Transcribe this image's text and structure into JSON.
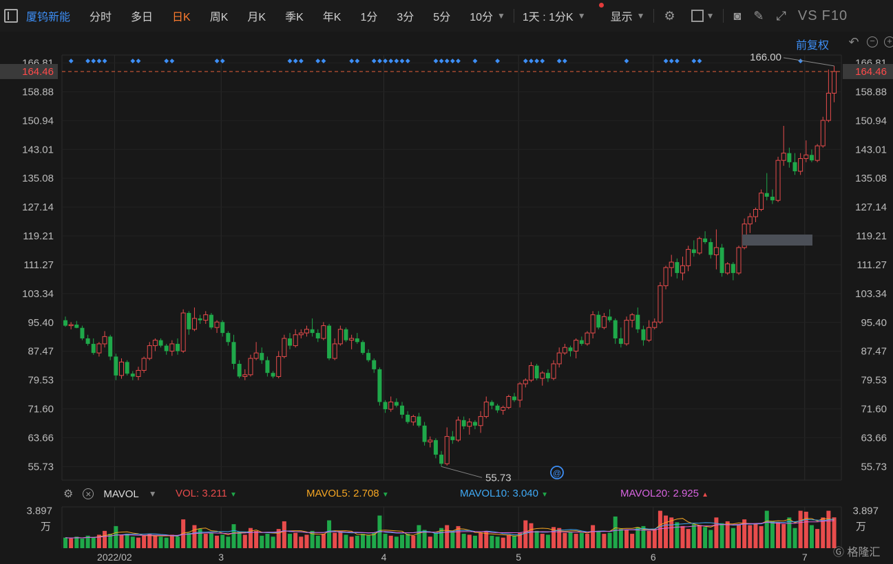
{
  "toolbar": {
    "stock_name": "厦钨新能",
    "periods": [
      "分时",
      "多日",
      "日K",
      "周K",
      "月K",
      "季K",
      "年K",
      "1分",
      "3分",
      "5分",
      "10分"
    ],
    "active_period": "日K",
    "interval": "1天 : 1分K",
    "display": "显示",
    "vs_label": "VS",
    "f10_label": "F10"
  },
  "adjust_label": "前复权",
  "price_axis": {
    "ticks": [
      "166.81",
      "158.88",
      "150.94",
      "143.01",
      "135.08",
      "127.14",
      "119.21",
      "111.27",
      "103.34",
      "95.40",
      "87.47",
      "79.53",
      "71.60",
      "63.66",
      "55.73"
    ],
    "current": "164.46",
    "max_label": "166.00",
    "min_label": "55.73"
  },
  "date_axis": {
    "labels": [
      {
        "text": "2022/02",
        "index": 9
      },
      {
        "text": "3",
        "index": 28
      },
      {
        "text": "4",
        "index": 57
      },
      {
        "text": "5",
        "index": 81
      },
      {
        "text": "6",
        "index": 105
      },
      {
        "text": "7",
        "index": 132
      }
    ]
  },
  "volume_panel": {
    "name": "MAVOL",
    "vol_label": "VOL:",
    "vol_value": "3.211",
    "mavol5_label": "MAVOL5:",
    "mavol5_value": "2.708",
    "mavol10_label": "MAVOL10:",
    "mavol10_value": "3.040",
    "mavol20_label": "MAVOL20:",
    "mavol20_value": "2.925",
    "axis_top": "3.897",
    "axis_unit": "万",
    "colors": {
      "vol": "#e84c4c",
      "mavol5": "#f5a623",
      "mavol10": "#3fa9f5",
      "mavol20": "#d864e0"
    }
  },
  "brand": "格隆汇",
  "colors": {
    "up": "#e84c4c",
    "down": "#1fa84a",
    "accent": "#3d8ef5",
    "current_line": "#e8613a"
  },
  "chart_data": {
    "type": "candlestick",
    "price_range": [
      52,
      169
    ],
    "ohlc": [
      [
        96.0,
        97.0,
        94.2,
        94.5
      ],
      [
        94.5,
        95.5,
        93.5,
        94.8
      ],
      [
        94.8,
        95.8,
        93.8,
        93.9
      ],
      [
        93.9,
        94.5,
        90.5,
        91.0
      ],
      [
        91.0,
        92.0,
        89.0,
        89.5
      ],
      [
        89.5,
        91.0,
        86.5,
        87.0
      ],
      [
        87.0,
        90.0,
        86.0,
        89.5
      ],
      [
        89.5,
        93.0,
        88.5,
        91.5
      ],
      [
        91.5,
        92.0,
        85.0,
        86.0
      ],
      [
        86.0,
        86.8,
        79.5,
        80.8
      ],
      [
        80.8,
        85.5,
        79.9,
        84.5
      ],
      [
        84.5,
        85.0,
        80.8,
        81.3
      ],
      [
        81.3,
        82.0,
        79.5,
        80.5
      ],
      [
        80.5,
        83.2,
        79.5,
        82.2
      ],
      [
        82.2,
        86.0,
        81.5,
        85.5
      ],
      [
        85.5,
        90.0,
        85.0,
        89.0
      ],
      [
        89.0,
        91.0,
        87.5,
        90.5
      ],
      [
        90.5,
        91.0,
        88.5,
        89.0
      ],
      [
        89.0,
        89.5,
        86.5,
        87.5
      ],
      [
        87.5,
        90.5,
        86.2,
        89.5
      ],
      [
        89.5,
        91.0,
        86.5,
        87.5
      ],
      [
        87.5,
        99.0,
        87.0,
        98.0
      ],
      [
        98.0,
        98.5,
        92.0,
        93.5
      ],
      [
        93.5,
        99.5,
        93.0,
        96.5
      ],
      [
        96.5,
        97.5,
        95.0,
        96.0
      ],
      [
        96.0,
        98.5,
        95.0,
        97.5
      ],
      [
        97.5,
        98.0,
        93.5,
        94.0
      ],
      [
        94.0,
        96.0,
        92.5,
        95.5
      ],
      [
        95.5,
        96.0,
        91.5,
        92.5
      ],
      [
        92.5,
        93.0,
        89.0,
        90.0
      ],
      [
        90.0,
        92.0,
        82.5,
        84.0
      ],
      [
        84.0,
        85.0,
        80.0,
        80.5
      ],
      [
        80.5,
        82.5,
        79.5,
        81.0
      ],
      [
        81.0,
        86.5,
        80.5,
        85.5
      ],
      [
        85.5,
        90.0,
        85.0,
        87.0
      ],
      [
        87.0,
        88.5,
        84.0,
        85.0
      ],
      [
        85.0,
        86.0,
        80.5,
        81.5
      ],
      [
        81.5,
        82.0,
        80.0,
        80.5
      ],
      [
        80.5,
        87.5,
        80.0,
        86.0
      ],
      [
        86.0,
        92.0,
        85.5,
        91.0
      ],
      [
        91.0,
        92.5,
        88.0,
        89.0
      ],
      [
        89.0,
        93.5,
        88.5,
        92.0
      ],
      [
        92.0,
        93.5,
        91.0,
        92.5
      ],
      [
        92.5,
        94.5,
        91.5,
        93.5
      ],
      [
        93.5,
        96.5,
        91.5,
        92.5
      ],
      [
        92.5,
        93.5,
        90.0,
        91.0
      ],
      [
        91.0,
        95.5,
        90.5,
        94.5
      ],
      [
        94.5,
        95.0,
        85.0,
        85.5
      ],
      [
        85.5,
        91.0,
        85.0,
        89.5
      ],
      [
        89.5,
        94.5,
        89.0,
        93.5
      ],
      [
        93.5,
        94.0,
        90.0,
        90.5
      ],
      [
        90.5,
        92.0,
        88.0,
        91.0
      ],
      [
        91.0,
        92.5,
        89.5,
        90.0
      ],
      [
        90.0,
        90.5,
        86.5,
        87.0
      ],
      [
        87.0,
        88.0,
        84.5,
        85.0
      ],
      [
        85.0,
        85.5,
        81.5,
        82.5
      ],
      [
        82.5,
        83.0,
        72.5,
        73.5
      ],
      [
        73.5,
        74.0,
        70.5,
        71.5
      ],
      [
        71.5,
        75.0,
        70.8,
        73.5
      ],
      [
        73.5,
        74.5,
        72.0,
        72.5
      ],
      [
        72.5,
        73.5,
        69.0,
        70.0
      ],
      [
        70.0,
        71.0,
        67.5,
        68.0
      ],
      [
        68.0,
        70.0,
        67.0,
        69.5
      ],
      [
        69.5,
        70.5,
        66.5,
        67.0
      ],
      [
        67.0,
        68.0,
        61.5,
        62.5
      ],
      [
        62.5,
        64.0,
        61.0,
        63.0
      ],
      [
        63.0,
        63.5,
        58.0,
        59.0
      ],
      [
        59.0,
        60.0,
        55.73,
        56.5
      ],
      [
        56.5,
        66.5,
        56.0,
        64.0
      ],
      [
        64.0,
        65.5,
        62.0,
        63.0
      ],
      [
        63.0,
        69.5,
        62.5,
        68.5
      ],
      [
        68.5,
        69.5,
        66.0,
        66.8
      ],
      [
        66.8,
        69.0,
        64.5,
        68.0
      ],
      [
        68.0,
        68.5,
        66.0,
        67.0
      ],
      [
        67.0,
        71.0,
        65.0,
        69.5
      ],
      [
        69.5,
        75.0,
        69.0,
        73.5
      ],
      [
        73.5,
        74.0,
        71.5,
        72.5
      ],
      [
        72.5,
        73.0,
        70.5,
        71.2
      ],
      [
        71.2,
        72.5,
        70.0,
        72.0
      ],
      [
        72.0,
        75.5,
        71.5,
        75.0
      ],
      [
        75.0,
        76.0,
        73.5,
        74.0
      ],
      [
        74.0,
        79.0,
        72.0,
        78.5
      ],
      [
        78.5,
        80.0,
        77.5,
        79.5
      ],
      [
        79.5,
        84.5,
        79.0,
        83.5
      ],
      [
        83.5,
        84.0,
        79.5,
        80.0
      ],
      [
        80.0,
        82.0,
        78.0,
        81.5
      ],
      [
        81.5,
        82.5,
        79.0,
        80.0
      ],
      [
        80.0,
        85.0,
        79.5,
        84.0
      ],
      [
        84.0,
        88.5,
        83.0,
        87.0
      ],
      [
        87.0,
        89.5,
        86.5,
        88.5
      ],
      [
        88.5,
        89.0,
        86.0,
        87.5
      ],
      [
        87.5,
        91.0,
        85.5,
        90.5
      ],
      [
        90.5,
        91.5,
        89.0,
        89.5
      ],
      [
        89.5,
        93.0,
        89.0,
        92.5
      ],
      [
        92.5,
        98.5,
        91.0,
        97.5
      ],
      [
        97.5,
        98.5,
        93.5,
        94.0
      ],
      [
        94.0,
        98.0,
        93.5,
        97.0
      ],
      [
        97.0,
        99.0,
        95.5,
        96.0
      ],
      [
        96.0,
        96.5,
        89.5,
        91.0
      ],
      [
        91.0,
        94.0,
        88.5,
        89.5
      ],
      [
        89.5,
        97.0,
        89.0,
        96.0
      ],
      [
        96.0,
        98.0,
        94.0,
        97.5
      ],
      [
        97.5,
        99.5,
        92.5,
        93.5
      ],
      [
        93.5,
        94.5,
        89.0,
        90.5
      ],
      [
        90.5,
        96.0,
        90.0,
        94.0
      ],
      [
        94.0,
        96.5,
        93.5,
        95.5
      ],
      [
        95.5,
        106.5,
        95.0,
        105.5
      ],
      [
        105.5,
        111.0,
        104.5,
        110.5
      ],
      [
        110.5,
        114.0,
        108.0,
        112.0
      ],
      [
        112.0,
        113.0,
        107.5,
        109.0
      ],
      [
        109.0,
        113.5,
        107.0,
        111.0
      ],
      [
        111.0,
        116.5,
        109.5,
        115.5
      ],
      [
        115.5,
        118.0,
        113.5,
        114.5
      ],
      [
        114.5,
        119.0,
        114.0,
        118.5
      ],
      [
        118.5,
        120.5,
        117.0,
        117.5
      ],
      [
        117.5,
        118.5,
        113.0,
        114.0
      ],
      [
        114.0,
        121.0,
        110.0,
        116.0
      ],
      [
        116.0,
        117.0,
        108.0,
        109.0
      ],
      [
        109.0,
        112.0,
        108.5,
        111.5
      ],
      [
        111.5,
        112.0,
        107.0,
        109.0
      ],
      [
        109.0,
        116.5,
        108.5,
        116.0
      ],
      [
        116.0,
        124.0,
        115.5,
        122.5
      ],
      [
        122.5,
        125.5,
        120.0,
        124.5
      ],
      [
        124.5,
        127.0,
        123.0,
        126.5
      ],
      [
        126.5,
        132.0,
        126.0,
        131.0
      ],
      [
        131.0,
        136.5,
        129.0,
        130.0
      ],
      [
        130.0,
        132.0,
        128.0,
        129.0
      ],
      [
        129.0,
        141.0,
        128.5,
        140.0
      ],
      [
        140.0,
        149.5,
        138.5,
        142.0
      ],
      [
        142.0,
        143.5,
        138.0,
        139.5
      ],
      [
        139.5,
        142.0,
        136.0,
        137.0
      ],
      [
        137.0,
        142.0,
        136.0,
        140.5
      ],
      [
        140.5,
        145.5,
        139.5,
        141.5
      ],
      [
        141.5,
        143.0,
        139.5,
        140.0
      ],
      [
        140.0,
        144.5,
        139.5,
        144.0
      ],
      [
        144.0,
        152.0,
        143.5,
        151.0
      ],
      [
        151.0,
        165.0,
        150.5,
        158.5
      ],
      [
        158.5,
        166.0,
        156.0,
        164.46
      ]
    ],
    "volume": [
      1.1,
      1.0,
      1.2,
      1.0,
      1.3,
      1.1,
      1.4,
      1.8,
      1.5,
      2.3,
      1.4,
      1.5,
      1.2,
      1.1,
      1.3,
      1.5,
      1.3,
      1.2,
      1.1,
      1.4,
      1.2,
      3.0,
      1.6,
      2.4,
      2.0,
      1.5,
      1.6,
      1.3,
      1.4,
      1.2,
      2.5,
      1.7,
      1.4,
      2.1,
      1.8,
      1.3,
      1.5,
      1.2,
      2.0,
      2.8,
      1.5,
      1.6,
      1.2,
      1.4,
      1.8,
      1.3,
      1.5,
      2.9,
      1.6,
      1.7,
      1.4,
      1.2,
      1.3,
      1.5,
      1.4,
      1.6,
      3.4,
      1.5,
      1.3,
      1.2,
      1.4,
      1.5,
      1.3,
      2.4,
      1.9,
      1.2,
      1.6,
      2.1,
      2.4,
      1.7,
      2.3,
      1.5,
      1.4,
      1.3,
      1.6,
      1.8,
      1.3,
      1.2,
      1.1,
      1.4,
      1.3,
      1.6,
      2.9,
      2.6,
      1.8,
      1.5,
      1.4,
      2.2,
      2.1,
      1.6,
      1.7,
      1.5,
      1.6,
      1.5,
      2.4,
      1.8,
      1.5,
      1.6,
      3.3,
      2.0,
      1.9,
      1.5,
      2.2,
      2.3,
      1.8,
      2.0,
      3.9,
      3.4,
      3.2,
      2.7,
      2.3,
      2.0,
      2.5,
      2.4,
      2.2,
      1.9,
      3.2,
      2.6,
      2.8,
      2.1,
      2.5,
      3.0,
      2.4,
      2.6,
      2.3,
      3.9,
      2.8,
      2.7,
      2.5,
      3.2,
      2.1,
      3.9,
      3.8,
      2.4,
      2.0,
      3.2,
      3.9,
      3.211
    ],
    "volume_range": [
      0,
      4.3
    ]
  }
}
